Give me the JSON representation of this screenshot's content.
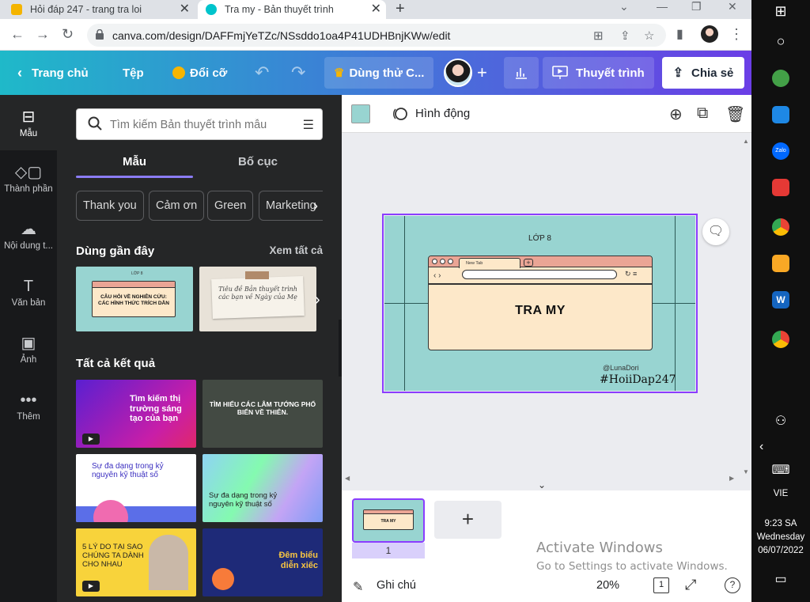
{
  "browser": {
    "tabs": [
      {
        "title": "Hỏi đáp 247 - trang tra loi",
        "active": false
      },
      {
        "title": "Tra my - Bản thuyết trình",
        "active": true
      }
    ],
    "url": "canva.com/design/DAFFmjYeTZc/NSsddo1oa4P41UDHBnjKWw/edit"
  },
  "topbar": {
    "home": "Trang chủ",
    "file": "Tệp",
    "resize": "Đổi cỡ",
    "trial": "Dùng thử C...",
    "present": "Thuyết trình",
    "share": "Chia sẻ"
  },
  "rail": [
    {
      "label": "Mẫu",
      "icon": "template-icon"
    },
    {
      "label": "Thành phần",
      "icon": "elements-icon"
    },
    {
      "label": "Nội dung t...",
      "icon": "upload-icon"
    },
    {
      "label": "Văn bản",
      "icon": "text-icon"
    },
    {
      "label": "Ảnh",
      "icon": "photo-icon"
    },
    {
      "label": "Thêm",
      "icon": "more-icon"
    }
  ],
  "panel": {
    "search_placeholder": "Tìm kiếm Bản thuyết trình mẫu",
    "tab_templates": "Mẫu",
    "tab_layouts": "Bố cục",
    "chips": [
      "Thank you",
      "Cảm ơn",
      "Green",
      "Marketing"
    ],
    "recent_title": "Dùng gần đây",
    "see_all": "Xem tất cả",
    "results_title": "Tất cả kết quả",
    "recent": [
      {
        "heading": "LỚP 8",
        "title": "CÂU HỎI VỀ NGHIÊN CỨU: CÁC HÌNH THỨC TRÍCH DẪN"
      },
      {
        "title": "Tiêu đề Bản thuyết trình các bạn về Ngày của Mẹ"
      }
    ],
    "results": [
      {
        "title": "Tìm kiếm thị trường sáng tạo của bạn"
      },
      {
        "title": "TÌM HIỂU CÁC LÂM TƯỚNG PHỔ BIẾN VỀ THIÊN."
      },
      {
        "title": "Sự đa dạng trong kỷ nguyên kỹ thuật số"
      },
      {
        "title": "Sự đa dạng trong kỷ nguyên kỹ thuật số"
      },
      {
        "title": "5 LÝ DO TẠI SAO CHÚNG TA DÀNH CHO NHAU"
      },
      {
        "title": "Đêm biểu diễn xiếc"
      }
    ]
  },
  "editor": {
    "animate": "Hình động",
    "slide": {
      "grade": "LỚP 8",
      "tab_label": "New Tab",
      "title": "TRA MY",
      "credit": "@LunaDori",
      "watermark": "#HoiiDap247"
    },
    "page_number": "1",
    "activate_title": "Activate Windows",
    "activate_sub": "Go to Settings to activate Windows.",
    "notes": "Ghi chú",
    "zoom": "20%",
    "page_count": "1"
  },
  "taskbar": {
    "lang": "VIE",
    "time": "9:23 SA",
    "day": "Wednesday",
    "date": "06/07/2022"
  },
  "colors": {
    "accent": "#8b3dff",
    "slide_bg": "#98d4d1",
    "panel_bg": "#252627",
    "rail_bg": "#18191b"
  }
}
